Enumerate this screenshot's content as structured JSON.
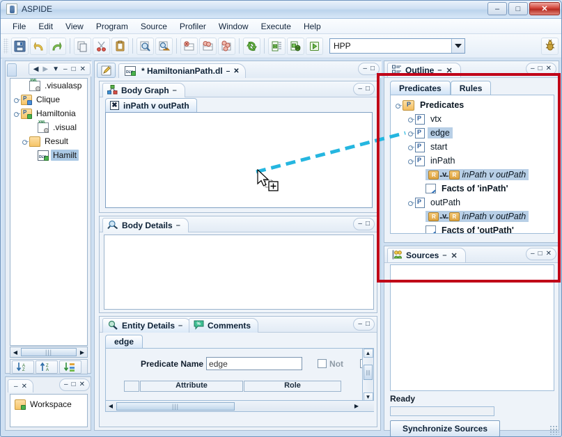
{
  "window": {
    "title": "ASPIDE",
    "app_icon": "java-coffee-icon",
    "minimize": "–",
    "maximize": "□",
    "close": "✕"
  },
  "menubar": {
    "items": [
      "File",
      "Edit",
      "View",
      "Program",
      "Source",
      "Profiler",
      "Window",
      "Execute",
      "Help"
    ]
  },
  "toolbar": {
    "buttons": [
      {
        "name": "save-button",
        "icon": "floppy-disk-icon"
      },
      {
        "name": "undo-button",
        "icon": "undo-arrow-icon"
      },
      {
        "name": "redo-button",
        "icon": "redo-arrow-icon"
      },
      {
        "name": "copy-button",
        "icon": "copy-icon"
      },
      {
        "name": "cut-button",
        "icon": "scissors-icon"
      },
      {
        "name": "paste-button",
        "icon": "clipboard-icon"
      },
      {
        "name": "find-button",
        "icon": "magnifier-icon"
      },
      {
        "name": "find-replace-button",
        "icon": "magnifier-replace-icon"
      },
      {
        "name": "delete-row-button",
        "icon": "row-delete-icon"
      },
      {
        "name": "edit-rows-button",
        "icon": "rows-edit-icon"
      },
      {
        "name": "manage-rows-button",
        "icon": "rows-stack-icon"
      },
      {
        "name": "refresh-button",
        "icon": "recycle-arrows-icon"
      },
      {
        "name": "run-config-button",
        "icon": "run-config-icon"
      },
      {
        "name": "debug-button",
        "icon": "debug-bug-icon"
      },
      {
        "name": "run-button",
        "icon": "play-arrow-icon"
      }
    ],
    "run_config": {
      "value": "HPP",
      "dropdown_icon": "chevron-down-icon"
    },
    "right_button": {
      "name": "bug-button",
      "icon": "bug-icon"
    }
  },
  "project_panel": {
    "nav": {
      "back_icon": "back-arrow-icon",
      "forward_icon": "forward-arrow-icon",
      "dropdown_icon": "chevron-down-icon",
      "minimize": "–",
      "maximize": "□",
      "close": "✕"
    },
    "tree": [
      {
        "label": ".visualasp",
        "indent": 1,
        "handle": "none",
        "icon": "xml-config-file-icon",
        "selected": false
      },
      {
        "label": "Clique",
        "indent": 0,
        "handle": "closed",
        "icon": "project-folder-icon",
        "selected": false
      },
      {
        "label": "Hamiltonia",
        "indent": 0,
        "handle": "open",
        "icon": "project-folder-icon",
        "selected": false
      },
      {
        "label": ".visual",
        "indent": 1,
        "handle": "none",
        "icon": "xml-config-file-icon",
        "selected": false
      },
      {
        "label": "Result",
        "indent": 1,
        "handle": "closed",
        "icon": "folder-icon",
        "selected": false
      },
      {
        "label": "Hamilt",
        "indent": 1,
        "handle": "none",
        "icon": "dlv-file-icon",
        "selected": true
      }
    ],
    "hscroll": {
      "left_arrow": "◀",
      "right_arrow": "▶",
      "thumb_grip": "|||"
    },
    "sort_buttons": [
      {
        "name": "sort-az-button",
        "icon": "sort-ascending-icon"
      },
      {
        "name": "sort-za-button",
        "icon": "sort-descending-icon"
      },
      {
        "name": "sort-custom-button",
        "icon": "sort-custom-icon"
      }
    ]
  },
  "workspace_panel": {
    "tab": {
      "minimize": "–",
      "close": "✕"
    },
    "frame_btns": {
      "minimize": "–",
      "maximize": "□",
      "close": "✕"
    },
    "item": {
      "label": "Workspace",
      "icon": "workspace-folder-icon"
    }
  },
  "editor": {
    "edit_icon": "pencil-edit-icon",
    "tab": {
      "label": "* HamiltonianPath.dl",
      "icon": "dlv-file-icon",
      "minimize": "–",
      "close": "✕"
    },
    "frame_btns": {
      "minimize": "–",
      "maximize": "□"
    }
  },
  "body_graph": {
    "title": "Body Graph",
    "icon": "graph-nodes-icon",
    "minimize": "–",
    "frame_btns": {
      "minimize": "–",
      "maximize": "□"
    },
    "inner_tab": {
      "label": "inPath v outPath",
      "close_icon": "x-box-icon"
    }
  },
  "body_details": {
    "title": "Body Details",
    "icon": "magnifier-details-icon",
    "minimize": "–",
    "frame_btns": {
      "minimize": "–",
      "maximize": "□"
    }
  },
  "entity_details": {
    "title": "Entity Details",
    "icon": "magnifier-green-icon",
    "minimize": "–",
    "comments_tab": {
      "label": "Comments",
      "icon": "comment-bubble-icon"
    },
    "frame_btns": {
      "minimize": "–",
      "maximize": "□"
    },
    "sub_tab": "edge",
    "form": {
      "predicate_name_label": "Predicate Name",
      "predicate_name_value": "edge",
      "not_label": "Not",
      "not_checked": false,
      "second_checkbox_checked": false
    },
    "table_headers": [
      "",
      "Attribute",
      "Role",
      ""
    ],
    "scroll": {
      "up": "▲",
      "down": "▼",
      "left": "◀",
      "right": "▶",
      "grip": "|||"
    }
  },
  "outline": {
    "title": "Outline",
    "icon": "outline-list-icon",
    "minimize": "–",
    "close": "✕",
    "frame_btns": {
      "minimize": "–",
      "maximize": "□",
      "close": "✕"
    },
    "tabs": [
      {
        "label": "Predicates",
        "selected": true
      },
      {
        "label": "Rules",
        "selected": false
      }
    ],
    "tree": [
      {
        "label": "Predicates",
        "indent": 0,
        "handle": "open",
        "icon": "predicates-root-icon",
        "kind": "root",
        "highlight": false
      },
      {
        "label": "vtx",
        "indent": 1,
        "handle": "closed",
        "icon": "predicate-icon",
        "kind": "pred",
        "highlight": false
      },
      {
        "label": "edge",
        "indent": 1,
        "handle": "closed",
        "icon": "predicate-icon",
        "kind": "pred",
        "highlight": true
      },
      {
        "label": "start",
        "indent": 1,
        "handle": "closed",
        "icon": "predicate-icon",
        "kind": "pred",
        "highlight": false
      },
      {
        "label": "inPath",
        "indent": 1,
        "handle": "open",
        "icon": "predicate-icon",
        "kind": "pred",
        "highlight": false
      },
      {
        "label": "inPath v outPath",
        "indent": 2,
        "handle": "none",
        "icon": "rule-disjunction-icon",
        "kind": "rule",
        "highlight": true
      },
      {
        "label": "Facts of 'inPath'",
        "indent": 2,
        "handle": "none",
        "icon": "facts-icon",
        "kind": "facts",
        "highlight": false
      },
      {
        "label": "outPath",
        "indent": 1,
        "handle": "open",
        "icon": "predicate-icon",
        "kind": "pred",
        "highlight": false
      },
      {
        "label": "inPath v outPath",
        "indent": 2,
        "handle": "none",
        "icon": "rule-disjunction-icon",
        "kind": "rule",
        "highlight": true
      },
      {
        "label": "Facts of 'outPath'",
        "indent": 2,
        "handle": "none",
        "icon": "facts-icon",
        "kind": "facts",
        "highlight": false
      }
    ],
    "rule_separator": "..v.."
  },
  "sources": {
    "title": "Sources",
    "icon": "sources-people-icon",
    "minimize": "–",
    "close": "✕",
    "frame_btns": {
      "minimize": "–",
      "maximize": "□",
      "close": "✕"
    },
    "status": "Ready",
    "sync_button": "Synchronize Sources"
  },
  "annotation": {
    "highlight_color": "#c00018",
    "drag_line_color": "#25b6e0",
    "cursor": "drag-copy-cursor"
  }
}
